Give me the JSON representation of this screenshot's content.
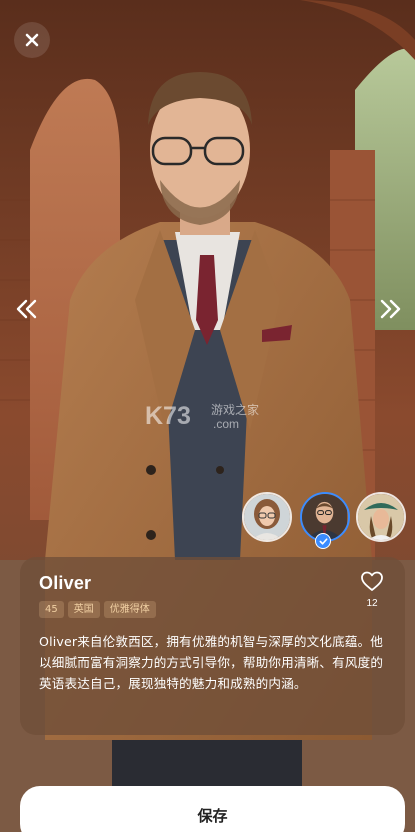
{
  "app": {
    "close_icon": "close-icon",
    "prev_icon": "double-chevron-left-icon",
    "next_icon": "double-chevron-right-icon"
  },
  "watermark": {
    "brand": "K73",
    "site_cn": "游戏之家",
    "domain": ".com"
  },
  "avatars": [
    {
      "name": "avatar-woman-glasses",
      "selected": false
    },
    {
      "name": "avatar-oliver",
      "selected": true
    },
    {
      "name": "avatar-woman-hat",
      "selected": false
    }
  ],
  "profile": {
    "name": "Oliver",
    "tags": [
      "45",
      "英国",
      "优雅得体"
    ],
    "likes": "12",
    "description": "Oliver来自伦敦西区，拥有优雅的机智与深厚的文化底蕴。他以细腻而富有洞察力的方式引导你，帮助你用清晰、有风度的英语表达自己，展现独特的魅力和成熟的内涵。"
  },
  "actions": {
    "save_label": "保存"
  },
  "colors": {
    "accent": "#3b8cff",
    "tag_text": "#f0cfa2",
    "card_bg": "#704e38"
  }
}
